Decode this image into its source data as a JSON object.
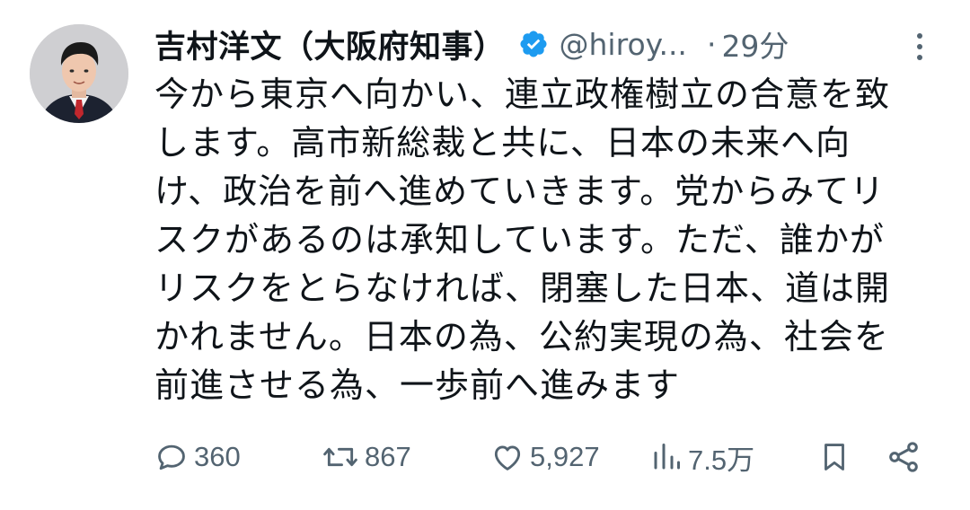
{
  "tweet": {
    "display_name": "吉村洋文（大阪府知事）",
    "handle": "@hiroy...",
    "separator": "·",
    "time": "29分",
    "text": "今から東京へ向かい、連立政権樹立の合意を致\nします。高市新総裁と共に、日本の未来へ向\nけ、政治を前へ進めていきます。党からみてリ\nスクがあるのは承知しています。ただ、誰かが\nリスクをとらなければ、閉塞した日本、道は開\nかれません。日本の為、公約実現の為、社会を\n前進させる為、一歩前へ進みます"
  },
  "actions": {
    "reply_count": "360",
    "retweet_count": "867",
    "like_count": "5,927",
    "views_count": "7.5万"
  },
  "icons": {
    "verified": "verified-badge-icon",
    "more": "more-vertical-icon",
    "reply": "reply-icon",
    "retweet": "retweet-icon",
    "like": "heart-icon",
    "views": "views-bar-chart-icon",
    "bookmark": "bookmark-icon",
    "share": "share-icon"
  },
  "colors": {
    "text": "#0f1419",
    "muted": "#536471",
    "verified": "#1d9bf0"
  }
}
